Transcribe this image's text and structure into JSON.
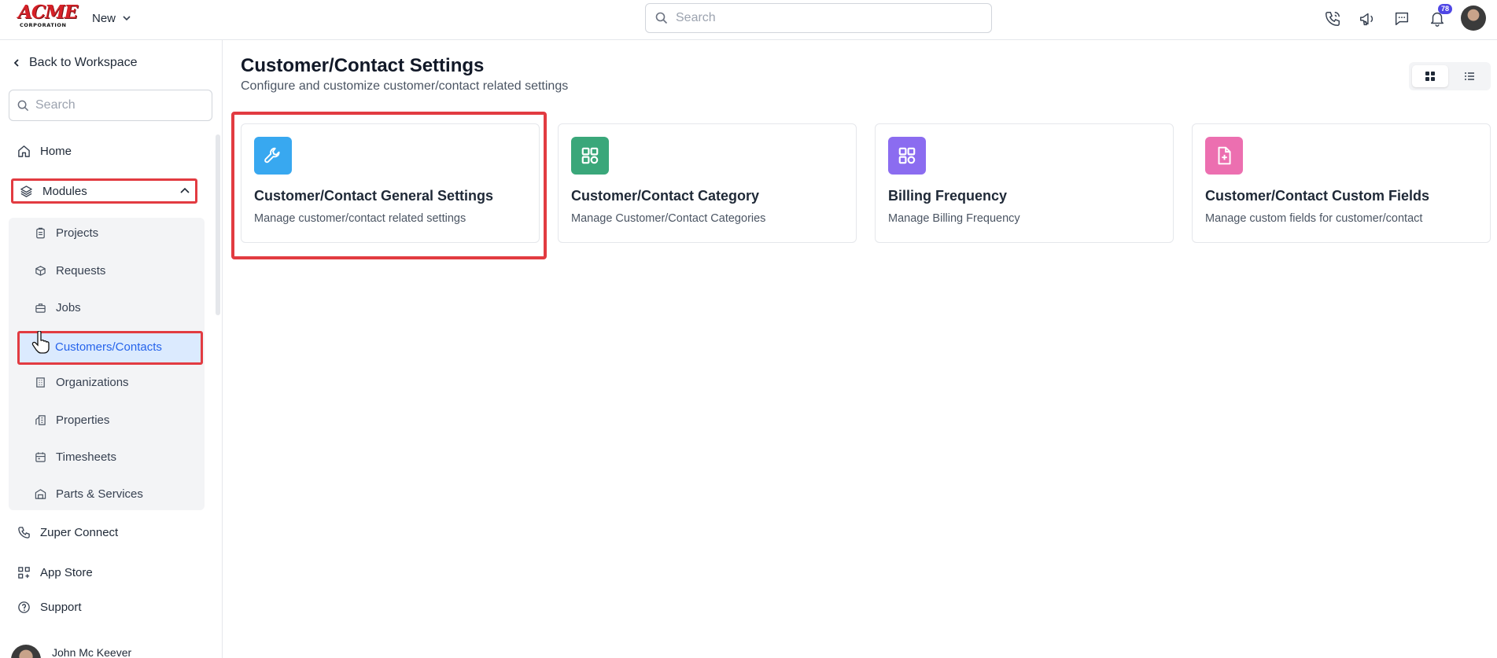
{
  "brand": {
    "logo_text": "ACME",
    "logo_sub": "CORPORATION"
  },
  "topbar": {
    "new_label": "New",
    "search_placeholder": "Search",
    "notification_count": "78",
    "icons": [
      "phone-icon",
      "megaphone-icon",
      "chat-icon",
      "bell-icon",
      "user-avatar"
    ]
  },
  "sidebar": {
    "back_label": "Back to Workspace",
    "search_placeholder": "Search",
    "home_label": "Home",
    "modules_label": "Modules",
    "modules_items": [
      {
        "label": "Projects",
        "icon": "clipboard-icon"
      },
      {
        "label": "Requests",
        "icon": "box-icon"
      },
      {
        "label": "Jobs",
        "icon": "briefcase-icon"
      },
      {
        "label": "Customers/Contacts",
        "icon": "users-icon",
        "active": true
      },
      {
        "label": "Organizations",
        "icon": "building-icon"
      },
      {
        "label": "Properties",
        "icon": "property-icon"
      },
      {
        "label": "Timesheets",
        "icon": "calendar-icon"
      },
      {
        "label": "Parts & Services",
        "icon": "warehouse-icon"
      }
    ],
    "connect_label": "Zuper Connect",
    "appstore_label": "App Store",
    "support_label": "Support",
    "user_name": "John Mc Keever"
  },
  "main": {
    "title": "Customer/Contact Settings",
    "subtitle": "Configure and customize customer/contact related settings",
    "view_modes": [
      "grid",
      "list"
    ],
    "cards": [
      {
        "title": "Customer/Contact General Settings",
        "description": "Manage customer/contact related settings",
        "icon": "wrench-icon",
        "color": "#38a8f0"
      },
      {
        "title": "Customer/Contact Category",
        "description": "Manage Customer/Contact Categories",
        "icon": "grid-icon",
        "color": "#3aa77a"
      },
      {
        "title": "Billing Frequency",
        "description": "Manage Billing Frequency",
        "icon": "grid-icon",
        "color": "#8b6cf0"
      },
      {
        "title": "Customer/Contact Custom Fields",
        "description": "Manage custom fields for customer/contact",
        "icon": "file-plus-icon",
        "color": "#ec6fb0"
      }
    ]
  },
  "colors": {
    "highlight": "#e23b41",
    "active_bg": "#dbeafe",
    "active_text": "#2563eb"
  }
}
